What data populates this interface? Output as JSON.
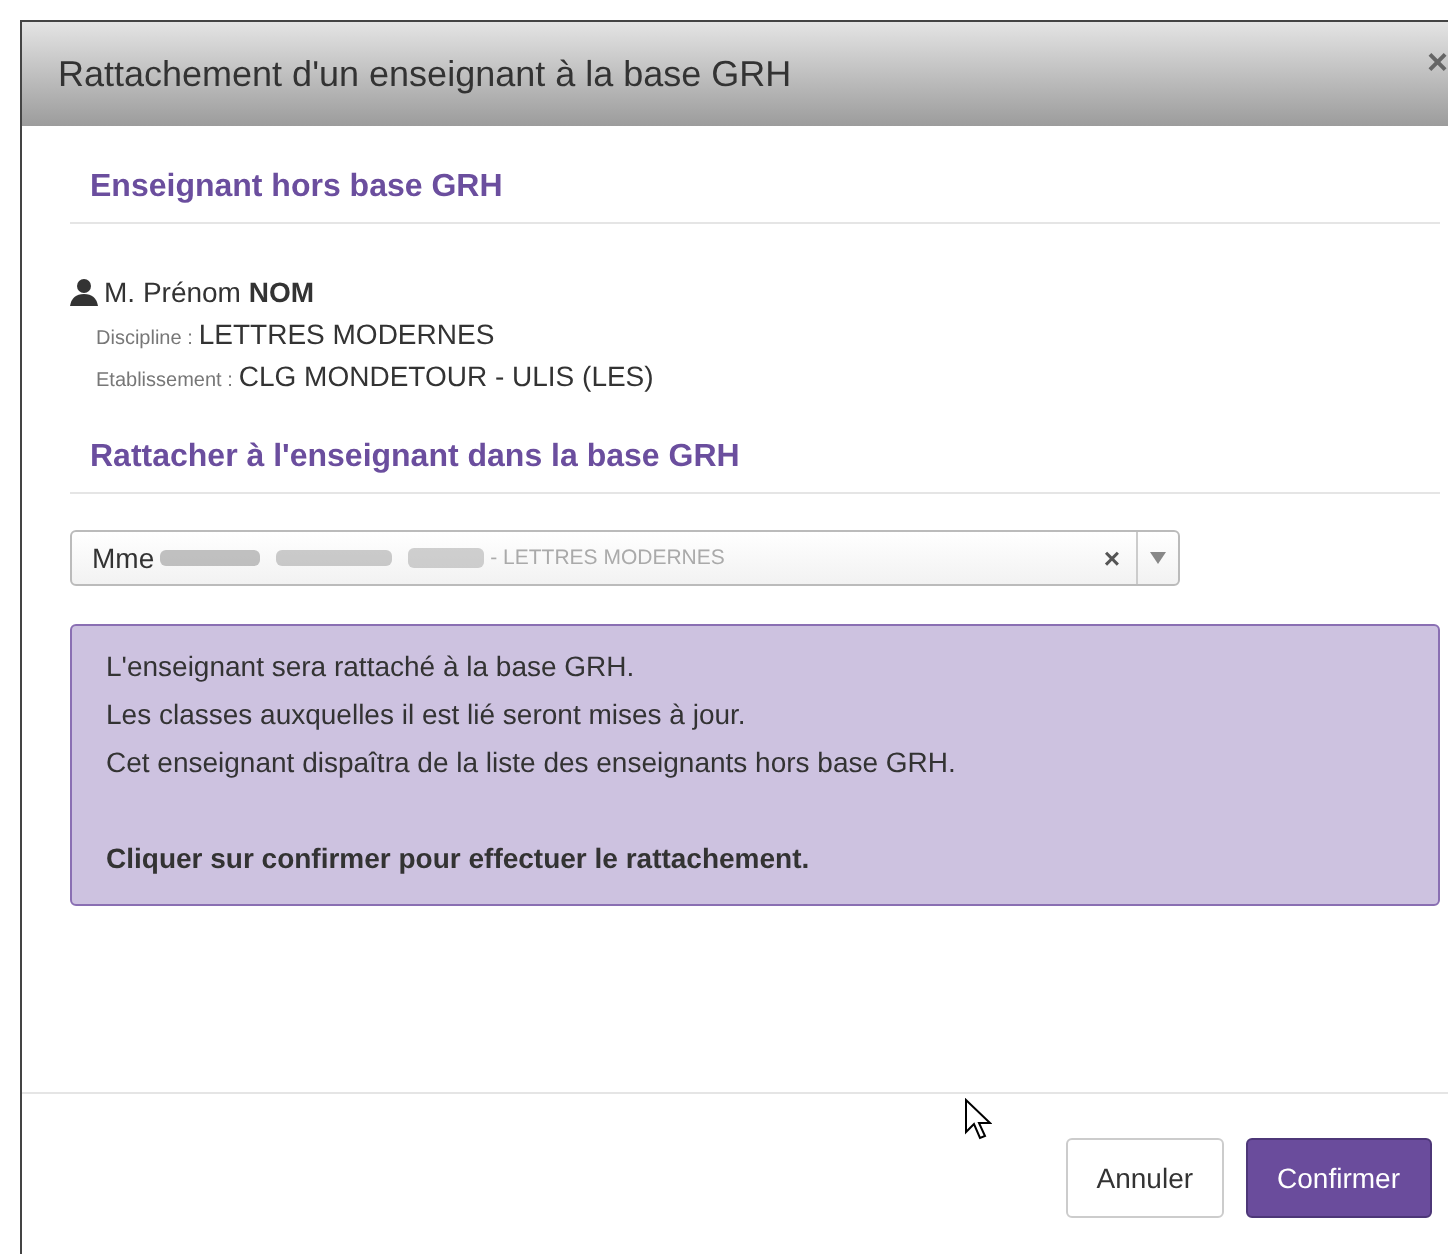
{
  "dialog": {
    "title": "Rattachement d'un enseignant à la base GRH",
    "close": "×"
  },
  "teacher_section": {
    "heading": "Enseignant hors base GRH",
    "name": "M. Prénom **NOM**",
    "fields": [
      {
        "label": "Discipline :",
        "value": "LETTRES MODERNES"
      },
      {
        "label": "Etablissement :",
        "value": "CLG MONDETOUR - ULIS (LES)"
      }
    ]
  },
  "link_section": {
    "heading": "Rattacher à l'enseignant dans la base GRH",
    "select": {
      "title": "Mme",
      "detail": "- LETTRES MODERNES",
      "clear": "×"
    }
  },
  "alert": {
    "lines": [
      "L'enseignant sera rattaché à la base GRH.",
      "Les classes auxquelles il est lié seront mises à jour.",
      "Cet enseignant dispaîtra de la liste des enseignants hors base GRH."
    ],
    "emphasis": "Cliquer sur confirmer pour effectuer le rattachement."
  },
  "buttons": [
    {
      "label": "Annuler",
      "kind": "default"
    },
    {
      "label": "Confirmer",
      "kind": "primary"
    }
  ]
}
